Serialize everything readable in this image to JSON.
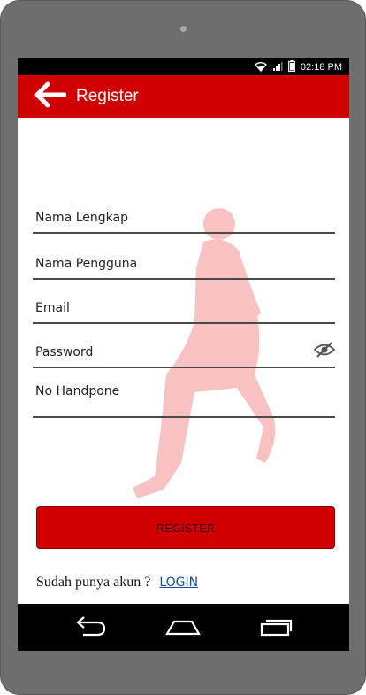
{
  "status_bar": {
    "time": "02:18 PM"
  },
  "app_bar": {
    "title": "Register"
  },
  "form": {
    "full_name_placeholder": "Nama Lengkap",
    "username_placeholder": "Nama Pengguna",
    "email_placeholder": "Email",
    "password_placeholder": "Password",
    "phone_placeholder": "No Handpone"
  },
  "register_button": {
    "label": "REGISTER"
  },
  "login_prompt": {
    "text": "Sudah punya akun ?",
    "link_label": "LOGIN"
  },
  "colors": {
    "accent": "#d10000",
    "link": "#1a4f9c"
  },
  "icons": [
    "back-arrow-icon",
    "wifi-icon",
    "signal-icon",
    "battery-icon",
    "eye-slash-icon",
    "nav-back-icon",
    "nav-home-icon",
    "nav-recents-icon"
  ]
}
